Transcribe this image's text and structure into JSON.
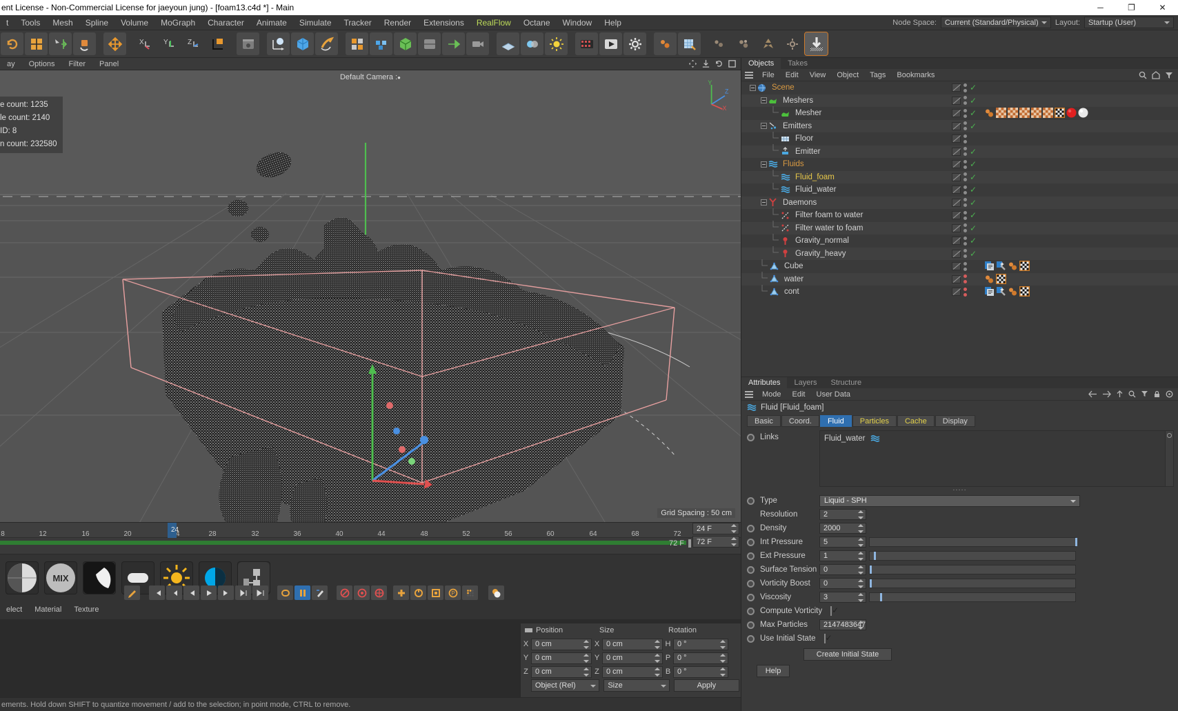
{
  "window": {
    "title": "ent License - Non-Commercial License for jaeyoun jung) - [foam13.c4d *] - Main",
    "minimize": "─",
    "maximize": "❐",
    "close": "✕"
  },
  "menubar": {
    "items": [
      "t",
      "Tools",
      "Mesh",
      "Spline",
      "Volume",
      "MoGraph",
      "Character",
      "Animate",
      "Simulate",
      "Tracker",
      "Render",
      "Extensions",
      "RealFlow",
      "Octane",
      "Window",
      "Help"
    ],
    "accent_item": "RealFlow",
    "accent_color": "#bedc5a",
    "node_space_label": "Node Space:",
    "node_space_value": "Current (Standard/Physical)",
    "layout_label": "Layout:",
    "layout_value": "Startup (User)"
  },
  "viewport": {
    "tabs": [
      "ay",
      "Options",
      "Filter",
      "Panel"
    ],
    "camera_label": "Default Camera",
    "hud": [
      "e count: 1235",
      "le count: 2140",
      " ID: 8",
      "n count: 232580"
    ],
    "grid_spacing": "Grid Spacing : 50 cm",
    "axis": {
      "x": "X",
      "y": "Y",
      "z": "Z"
    }
  },
  "timeline": {
    "ticks": [
      "8",
      "12",
      "16",
      "20",
      "24",
      "28",
      "32",
      "36",
      "40",
      "44",
      "48",
      "52",
      "56",
      "60",
      "64",
      "68",
      "72"
    ],
    "current_frame_marker": "24",
    "current_frame_field": "24 F",
    "end_frame_field": "72 F",
    "range_end_label": "72 F",
    "range_end_field": "72 F"
  },
  "material_manager": {
    "menu": [
      "elect",
      "Material",
      "Texture"
    ],
    "materials": [
      "checker-material",
      "mix-material",
      "shadow-material",
      "capsule-material",
      "sun-material",
      "contrast-material",
      "node-material"
    ]
  },
  "anim_toolbar": {
    "buttons": [
      "record-keyframe",
      "go-to-start",
      "step-back-frame",
      "step-back",
      "play",
      "step-forward",
      "go-to-end",
      "last-frame",
      "loop",
      "keyframe-mode",
      "autokey",
      "record-position",
      "record-scale",
      "record-rotation",
      "record-param",
      "record-point",
      "keyframe-selection",
      "project-settings"
    ]
  },
  "coords": {
    "headers": [
      "Position",
      "Size",
      "Rotation"
    ],
    "rows": [
      {
        "axis1": "X",
        "pos": "0 cm",
        "axis2": "X",
        "size": "0 cm",
        "axis3": "H",
        "rot": "0 °"
      },
      {
        "axis1": "Y",
        "pos": "0 cm",
        "axis2": "Y",
        "size": "0 cm",
        "axis3": "P",
        "rot": "0 °"
      },
      {
        "axis1": "Z",
        "pos": "0 cm",
        "axis2": "Z",
        "size": "0 cm",
        "axis3": "B",
        "rot": "0 °"
      }
    ],
    "mode_select": "Object (Rel)",
    "size_select": "Size",
    "apply_button": "Apply"
  },
  "statusbar": {
    "text": "ements. Hold down SHIFT to quantize movement / add to the selection; in point mode, CTRL to remove."
  },
  "objects_panel": {
    "tabs": [
      {
        "label": "Objects",
        "active": true
      },
      {
        "label": "Takes",
        "active": false
      }
    ],
    "menu": [
      "File",
      "Edit",
      "View",
      "Object",
      "Tags",
      "Bookmarks"
    ],
    "tree": [
      {
        "name": "Scene",
        "indent": 0,
        "color": "orange",
        "icon": "scene-icon",
        "expander": true,
        "visdots": "gray",
        "check": true,
        "tags": []
      },
      {
        "name": "Meshers",
        "indent": 1,
        "color": "normal",
        "icon": "mesher-icon",
        "expander": true,
        "visdots": "gray",
        "check": true,
        "tags": []
      },
      {
        "name": "Mesher",
        "indent": 2,
        "color": "normal",
        "icon": "mesher-icon",
        "expander": false,
        "visdots": "gray",
        "check": true,
        "tags": [
          "particle",
          "checker",
          "checker",
          "checker",
          "checker",
          "checker",
          "checker-box",
          "red-sphere",
          "white-sphere"
        ]
      },
      {
        "name": "Emitters",
        "indent": 1,
        "color": "normal",
        "icon": "emitter-icon",
        "expander": true,
        "visdots": "gray",
        "check": true,
        "tags": []
      },
      {
        "name": "Floor",
        "indent": 2,
        "color": "normal",
        "icon": "floor-icon",
        "expander": false,
        "visdots": "gray",
        "check": false,
        "tags": []
      },
      {
        "name": "Emitter",
        "indent": 2,
        "color": "normal",
        "icon": "emitterobj-icon",
        "expander": false,
        "visdots": "gray",
        "check": true,
        "tags": []
      },
      {
        "name": "Fluids",
        "indent": 1,
        "color": "orange",
        "icon": "fluid-icon",
        "expander": true,
        "visdots": "gray",
        "check": true,
        "tags": []
      },
      {
        "name": "Fluid_foam",
        "indent": 2,
        "color": "yellow",
        "icon": "fluid-icon",
        "expander": false,
        "visdots": "gray",
        "check": true,
        "tags": []
      },
      {
        "name": "Fluid_water",
        "indent": 2,
        "color": "normal",
        "icon": "fluid-icon",
        "expander": false,
        "visdots": "gray",
        "check": true,
        "tags": []
      },
      {
        "name": "Daemons",
        "indent": 1,
        "color": "normal",
        "icon": "daemon-icon",
        "expander": true,
        "visdots": "gray",
        "check": true,
        "tags": []
      },
      {
        "name": "Filter foam to water",
        "indent": 2,
        "color": "normal",
        "icon": "filter-icon",
        "expander": false,
        "visdots": "gray",
        "check": true,
        "tags": []
      },
      {
        "name": "Filter water to foam",
        "indent": 2,
        "color": "normal",
        "icon": "filter-icon",
        "expander": false,
        "visdots": "gray",
        "check": true,
        "tags": []
      },
      {
        "name": "Gravity_normal",
        "indent": 2,
        "color": "normal",
        "icon": "gravity-icon",
        "expander": false,
        "visdots": "gray",
        "check": true,
        "tags": []
      },
      {
        "name": "Gravity_heavy",
        "indent": 2,
        "color": "normal",
        "icon": "gravity-icon",
        "expander": false,
        "visdots": "gray",
        "check": true,
        "tags": []
      },
      {
        "name": "Cube",
        "indent": 1,
        "color": "normal",
        "icon": "null-icon",
        "expander": false,
        "visdots": "gray",
        "check": false,
        "tags": [
          "blue-doc",
          "blue-wand",
          "particle",
          "checker-box"
        ]
      },
      {
        "name": "water",
        "indent": 1,
        "color": "normal",
        "icon": "null-icon",
        "expander": false,
        "visdots": "red",
        "check": false,
        "tags": [
          "particle",
          "checker-box"
        ]
      },
      {
        "name": "cont",
        "indent": 1,
        "color": "normal",
        "icon": "null-icon",
        "expander": false,
        "visdots": "red",
        "check": false,
        "tags": [
          "blue-doc",
          "blue-wand",
          "particle",
          "checker-box"
        ]
      }
    ]
  },
  "attributes_panel": {
    "tabs": [
      {
        "label": "Attributes",
        "active": true
      },
      {
        "label": "Layers",
        "active": false
      },
      {
        "label": "Structure",
        "active": false
      }
    ],
    "menu": [
      "Mode",
      "Edit",
      "User Data"
    ],
    "object_line": "Fluid [Fluid_foam]",
    "subtabs": [
      {
        "label": "Basic",
        "state": "normal"
      },
      {
        "label": "Coord.",
        "state": "normal"
      },
      {
        "label": "Fluid",
        "state": "active"
      },
      {
        "label": "Particles",
        "state": "yellow"
      },
      {
        "label": "Cache",
        "state": "yellow"
      },
      {
        "label": "Display",
        "state": "normal"
      }
    ],
    "links_label": "Links",
    "links_value": "Fluid_water",
    "params": [
      {
        "label": "Type",
        "value": "Liquid - SPH",
        "kind": "dropdown",
        "radio": true,
        "slider": null
      },
      {
        "label": "Resolution",
        "value": "2",
        "kind": "number",
        "radio": false,
        "slider": null
      },
      {
        "label": "Density",
        "value": "2000",
        "kind": "number",
        "radio": true,
        "slider": null
      },
      {
        "label": "Int Pressure",
        "value": "5",
        "kind": "number",
        "radio": true,
        "slider": 100
      },
      {
        "label": "Ext Pressure",
        "value": "1",
        "kind": "number",
        "radio": true,
        "slider": 2
      },
      {
        "label": "Surface Tension",
        "value": "0",
        "kind": "number",
        "radio": true,
        "slider": 0
      },
      {
        "label": "Vorticity Boost",
        "value": "0",
        "kind": "number",
        "radio": true,
        "slider": 0
      },
      {
        "label": "Viscosity",
        "value": "3",
        "kind": "number",
        "radio": true,
        "slider": 5
      },
      {
        "label": "Compute Vorticity",
        "value": "",
        "kind": "checkbox",
        "radio": true,
        "slider": null,
        "checked": true
      },
      {
        "label": "Max Particles",
        "value": "2147483647",
        "kind": "number",
        "radio": true,
        "slider": null
      },
      {
        "label": "Use Initial State",
        "value": "",
        "kind": "checkbox",
        "radio": true,
        "slider": null,
        "checked": true
      }
    ],
    "create_initial_state": "Create Initial State",
    "help_button": "Help"
  },
  "colors": {
    "accent_blue": "#2f6fb0",
    "orange": "#d99a42",
    "yellow": "#e8c84a",
    "green_check": "#4caf50",
    "red_dot": "#d65c5c",
    "selection_box": "#e8a0a0"
  }
}
